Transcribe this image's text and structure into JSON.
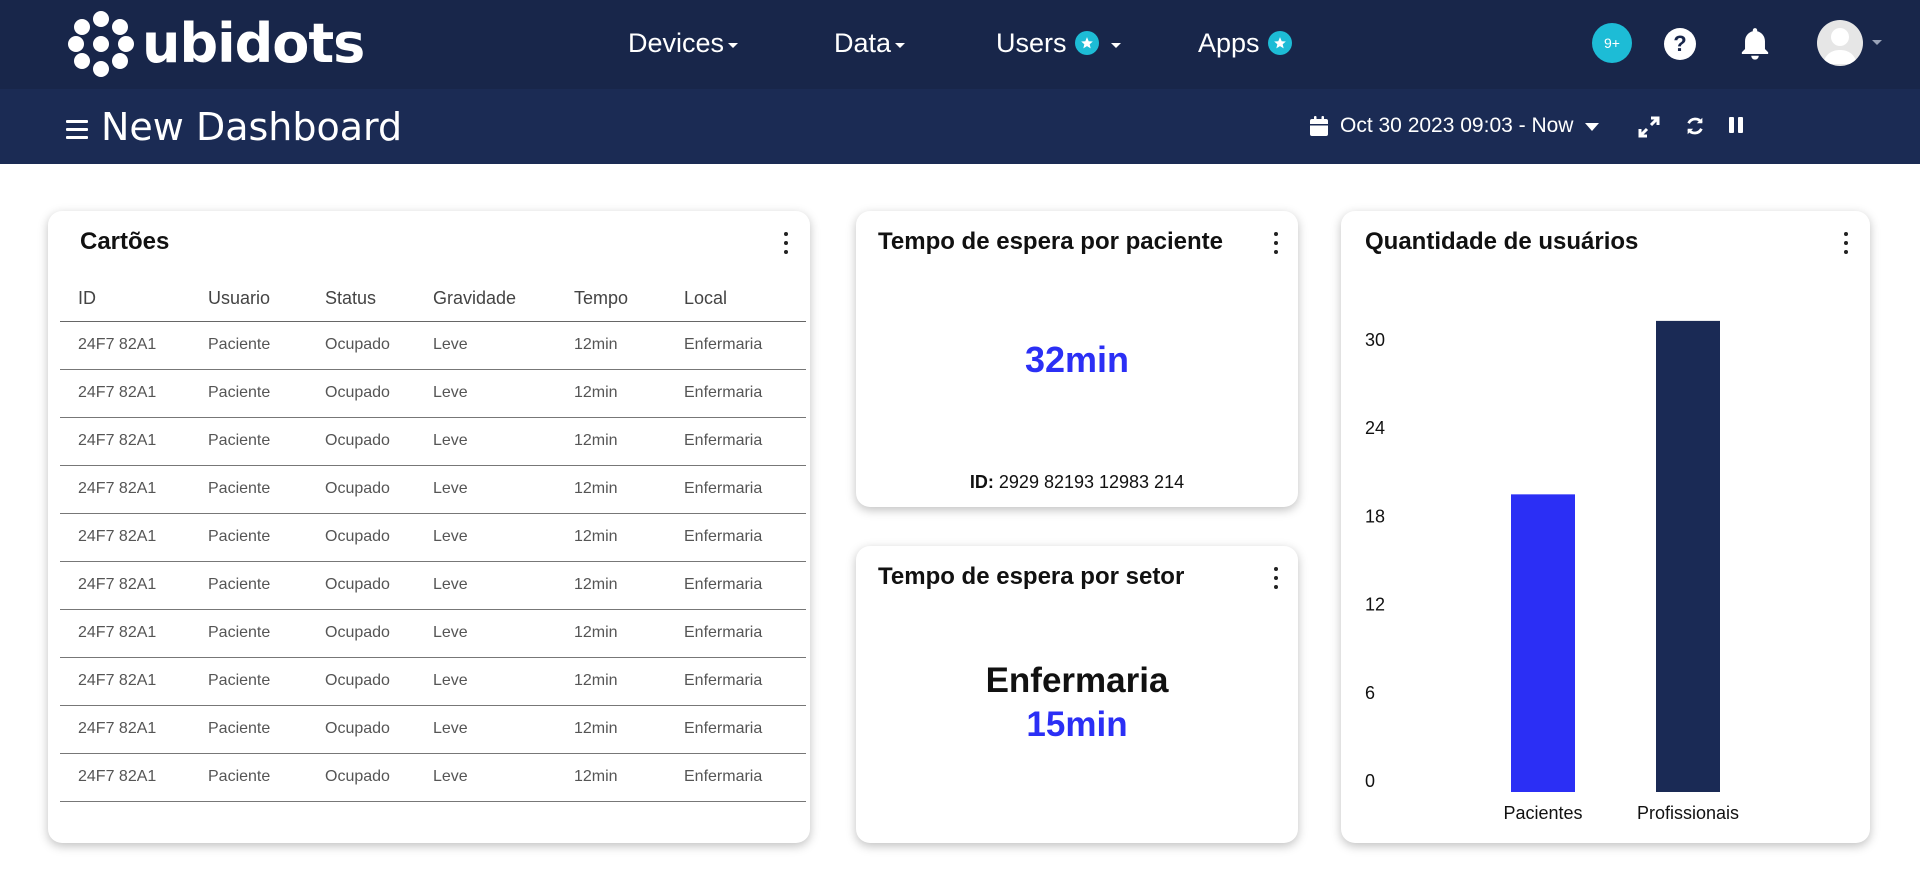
{
  "brand": {
    "name": "ubidots"
  },
  "nav": {
    "devices": "Devices",
    "data": "Data",
    "users": "Users",
    "apps": "Apps",
    "notifications_count": "9+",
    "help": "?"
  },
  "dashboard": {
    "title": "New Dashboard",
    "date_range": "Oct 30 2023 09:03 - Now"
  },
  "cards": {
    "table": {
      "title": "Cartões",
      "columns": [
        "ID",
        "Usuario",
        "Status",
        "Gravidade",
        "Tempo",
        "Local"
      ],
      "rows": [
        [
          "24F7 82A1",
          "Paciente",
          "Ocupado",
          "Leve",
          "12min",
          "Enfermaria"
        ],
        [
          "24F7 82A1",
          "Paciente",
          "Ocupado",
          "Leve",
          "12min",
          "Enfermaria"
        ],
        [
          "24F7 82A1",
          "Paciente",
          "Ocupado",
          "Leve",
          "12min",
          "Enfermaria"
        ],
        [
          "24F7 82A1",
          "Paciente",
          "Ocupado",
          "Leve",
          "12min",
          "Enfermaria"
        ],
        [
          "24F7 82A1",
          "Paciente",
          "Ocupado",
          "Leve",
          "12min",
          "Enfermaria"
        ],
        [
          "24F7 82A1",
          "Paciente",
          "Ocupado",
          "Leve",
          "12min",
          "Enfermaria"
        ],
        [
          "24F7 82A1",
          "Paciente",
          "Ocupado",
          "Leve",
          "12min",
          "Enfermaria"
        ],
        [
          "24F7 82A1",
          "Paciente",
          "Ocupado",
          "Leve",
          "12min",
          "Enfermaria"
        ],
        [
          "24F7 82A1",
          "Paciente",
          "Ocupado",
          "Leve",
          "12min",
          "Enfermaria"
        ],
        [
          "24F7 82A1",
          "Paciente",
          "Ocupado",
          "Leve",
          "12min",
          "Enfermaria"
        ]
      ]
    },
    "wait_patient": {
      "title": "Tempo de espera por paciente",
      "value": "32min",
      "id_label": "ID:",
      "id_value": "2929 82193 12983 214"
    },
    "wait_sector": {
      "title": "Tempo de espera por setor",
      "sector": "Enfermaria",
      "value": "15min"
    },
    "users_qty": {
      "title": "Quantidade de usuários"
    }
  },
  "colors": {
    "nav_bg": "#18264a",
    "bar_bg": "#1b2b54",
    "accent_blue": "#2b2ff5",
    "navy": "#1a2a55",
    "teal": "#1dbcd6"
  },
  "chart_data": {
    "type": "bar",
    "title": "Quantidade de usuários",
    "categories": [
      "Pacientes",
      "Profissionais"
    ],
    "values": [
      19.5,
      31.3
    ],
    "colors": [
      "#2b2ff5",
      "#1a2a55"
    ],
    "ylim": [
      0,
      30
    ],
    "yticks": [
      0,
      6,
      12,
      18,
      24,
      30
    ],
    "grid": false,
    "legend": "none",
    "xlabel": "",
    "ylabel": ""
  }
}
